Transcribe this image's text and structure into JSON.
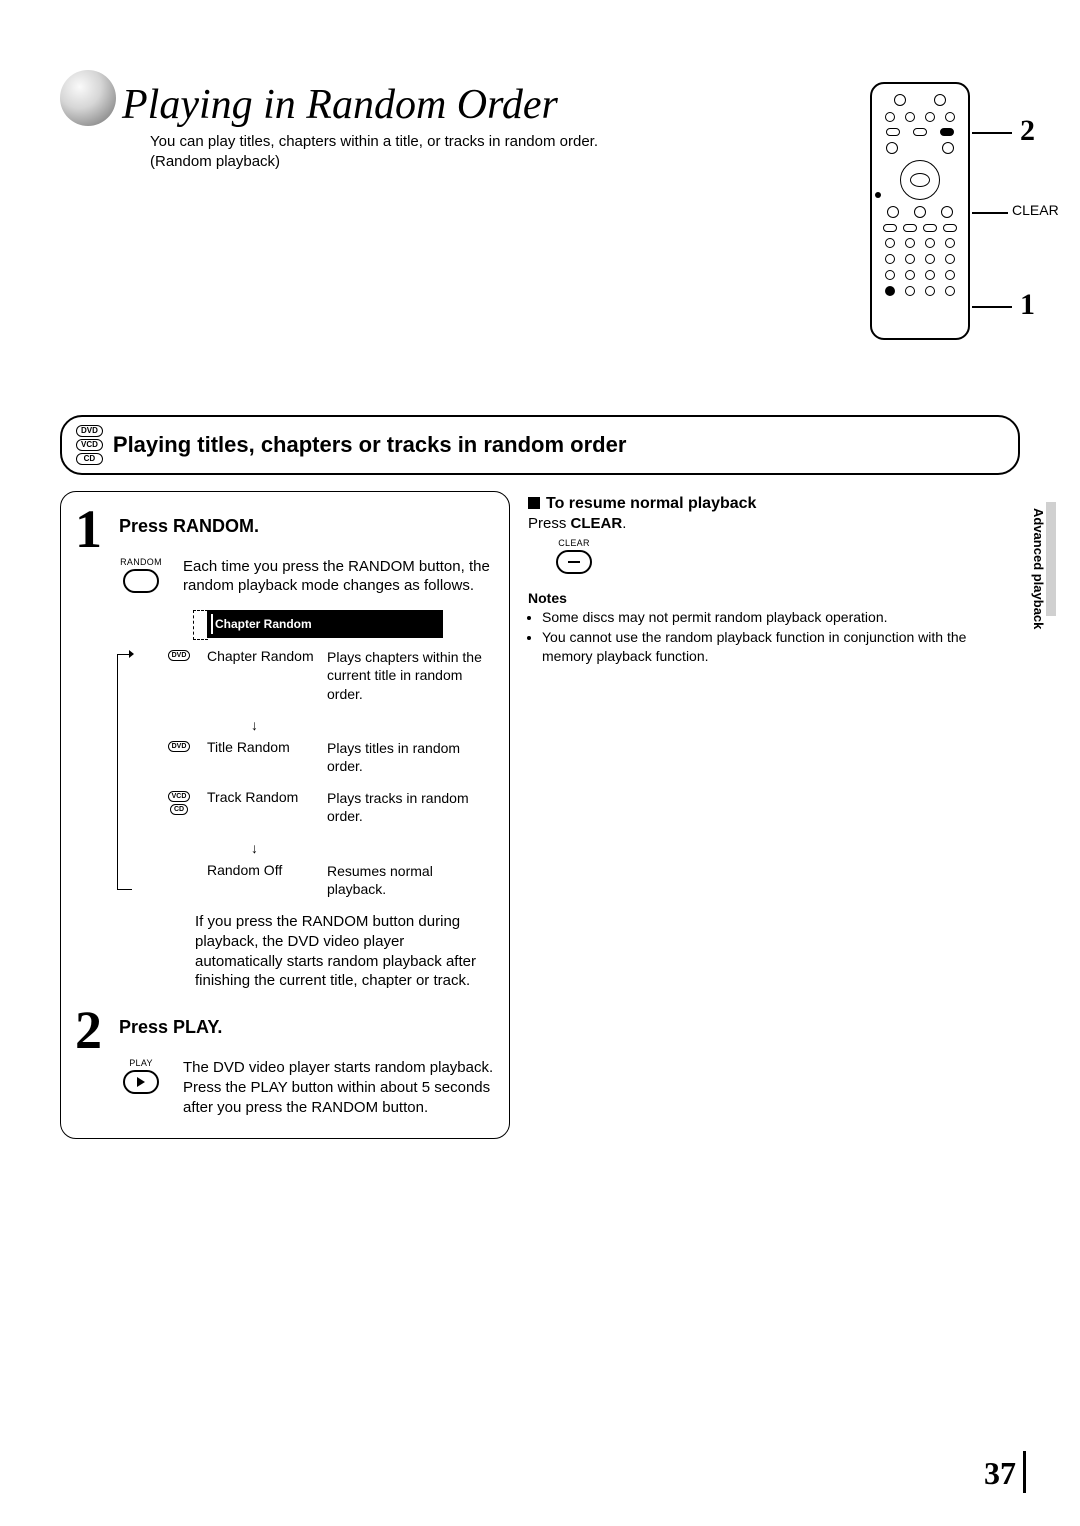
{
  "header": {
    "title": "Playing in Random Order",
    "intro_line1": "You can play titles, chapters within a title, or tracks in random order.",
    "intro_line2": "(Random playback)"
  },
  "remote": {
    "callout_2": "2",
    "callout_1": "1",
    "callout_clear": "CLEAR"
  },
  "section": {
    "media": [
      "DVD",
      "VCD",
      "CD"
    ],
    "title": "Playing titles, chapters or tracks in random order"
  },
  "step1": {
    "num": "1",
    "title": "Press RANDOM.",
    "button_label": "RANDOM",
    "desc": "Each time you press the RANDOM button, the random playback mode changes as follows.",
    "osd_text": "Chapter Random",
    "modes": [
      {
        "media": [
          "DVD"
        ],
        "name": "Chapter Random",
        "desc": "Plays chapters within the current title in random order."
      },
      {
        "media": [
          "DVD"
        ],
        "name": "Title Random",
        "desc": "Plays titles in random order."
      },
      {
        "media": [
          "VCD",
          "CD"
        ],
        "name": "Track Random",
        "desc": "Plays tracks in random order."
      },
      {
        "media": [],
        "name": "Random Off",
        "desc": "Resumes normal playback."
      }
    ],
    "after": "If you press the RANDOM button during playback, the DVD video player automatically starts random playback after finishing the current title, chapter or track."
  },
  "step2": {
    "num": "2",
    "title": "Press PLAY.",
    "button_label": "PLAY",
    "desc": "The DVD video player starts random playback.\nPress the PLAY button within about 5 seconds after you press the RANDOM button."
  },
  "resume": {
    "heading": "To resume normal playback",
    "line": "Press ",
    "bold": "CLEAR",
    "tail": ".",
    "btn_label": "CLEAR"
  },
  "notes": {
    "heading": "Notes",
    "items": [
      "Some discs may not permit random playback operation.",
      "You cannot use the random playback function in conjunction with the memory playback function."
    ]
  },
  "side_tab": "Advanced playback",
  "page_number": "37"
}
